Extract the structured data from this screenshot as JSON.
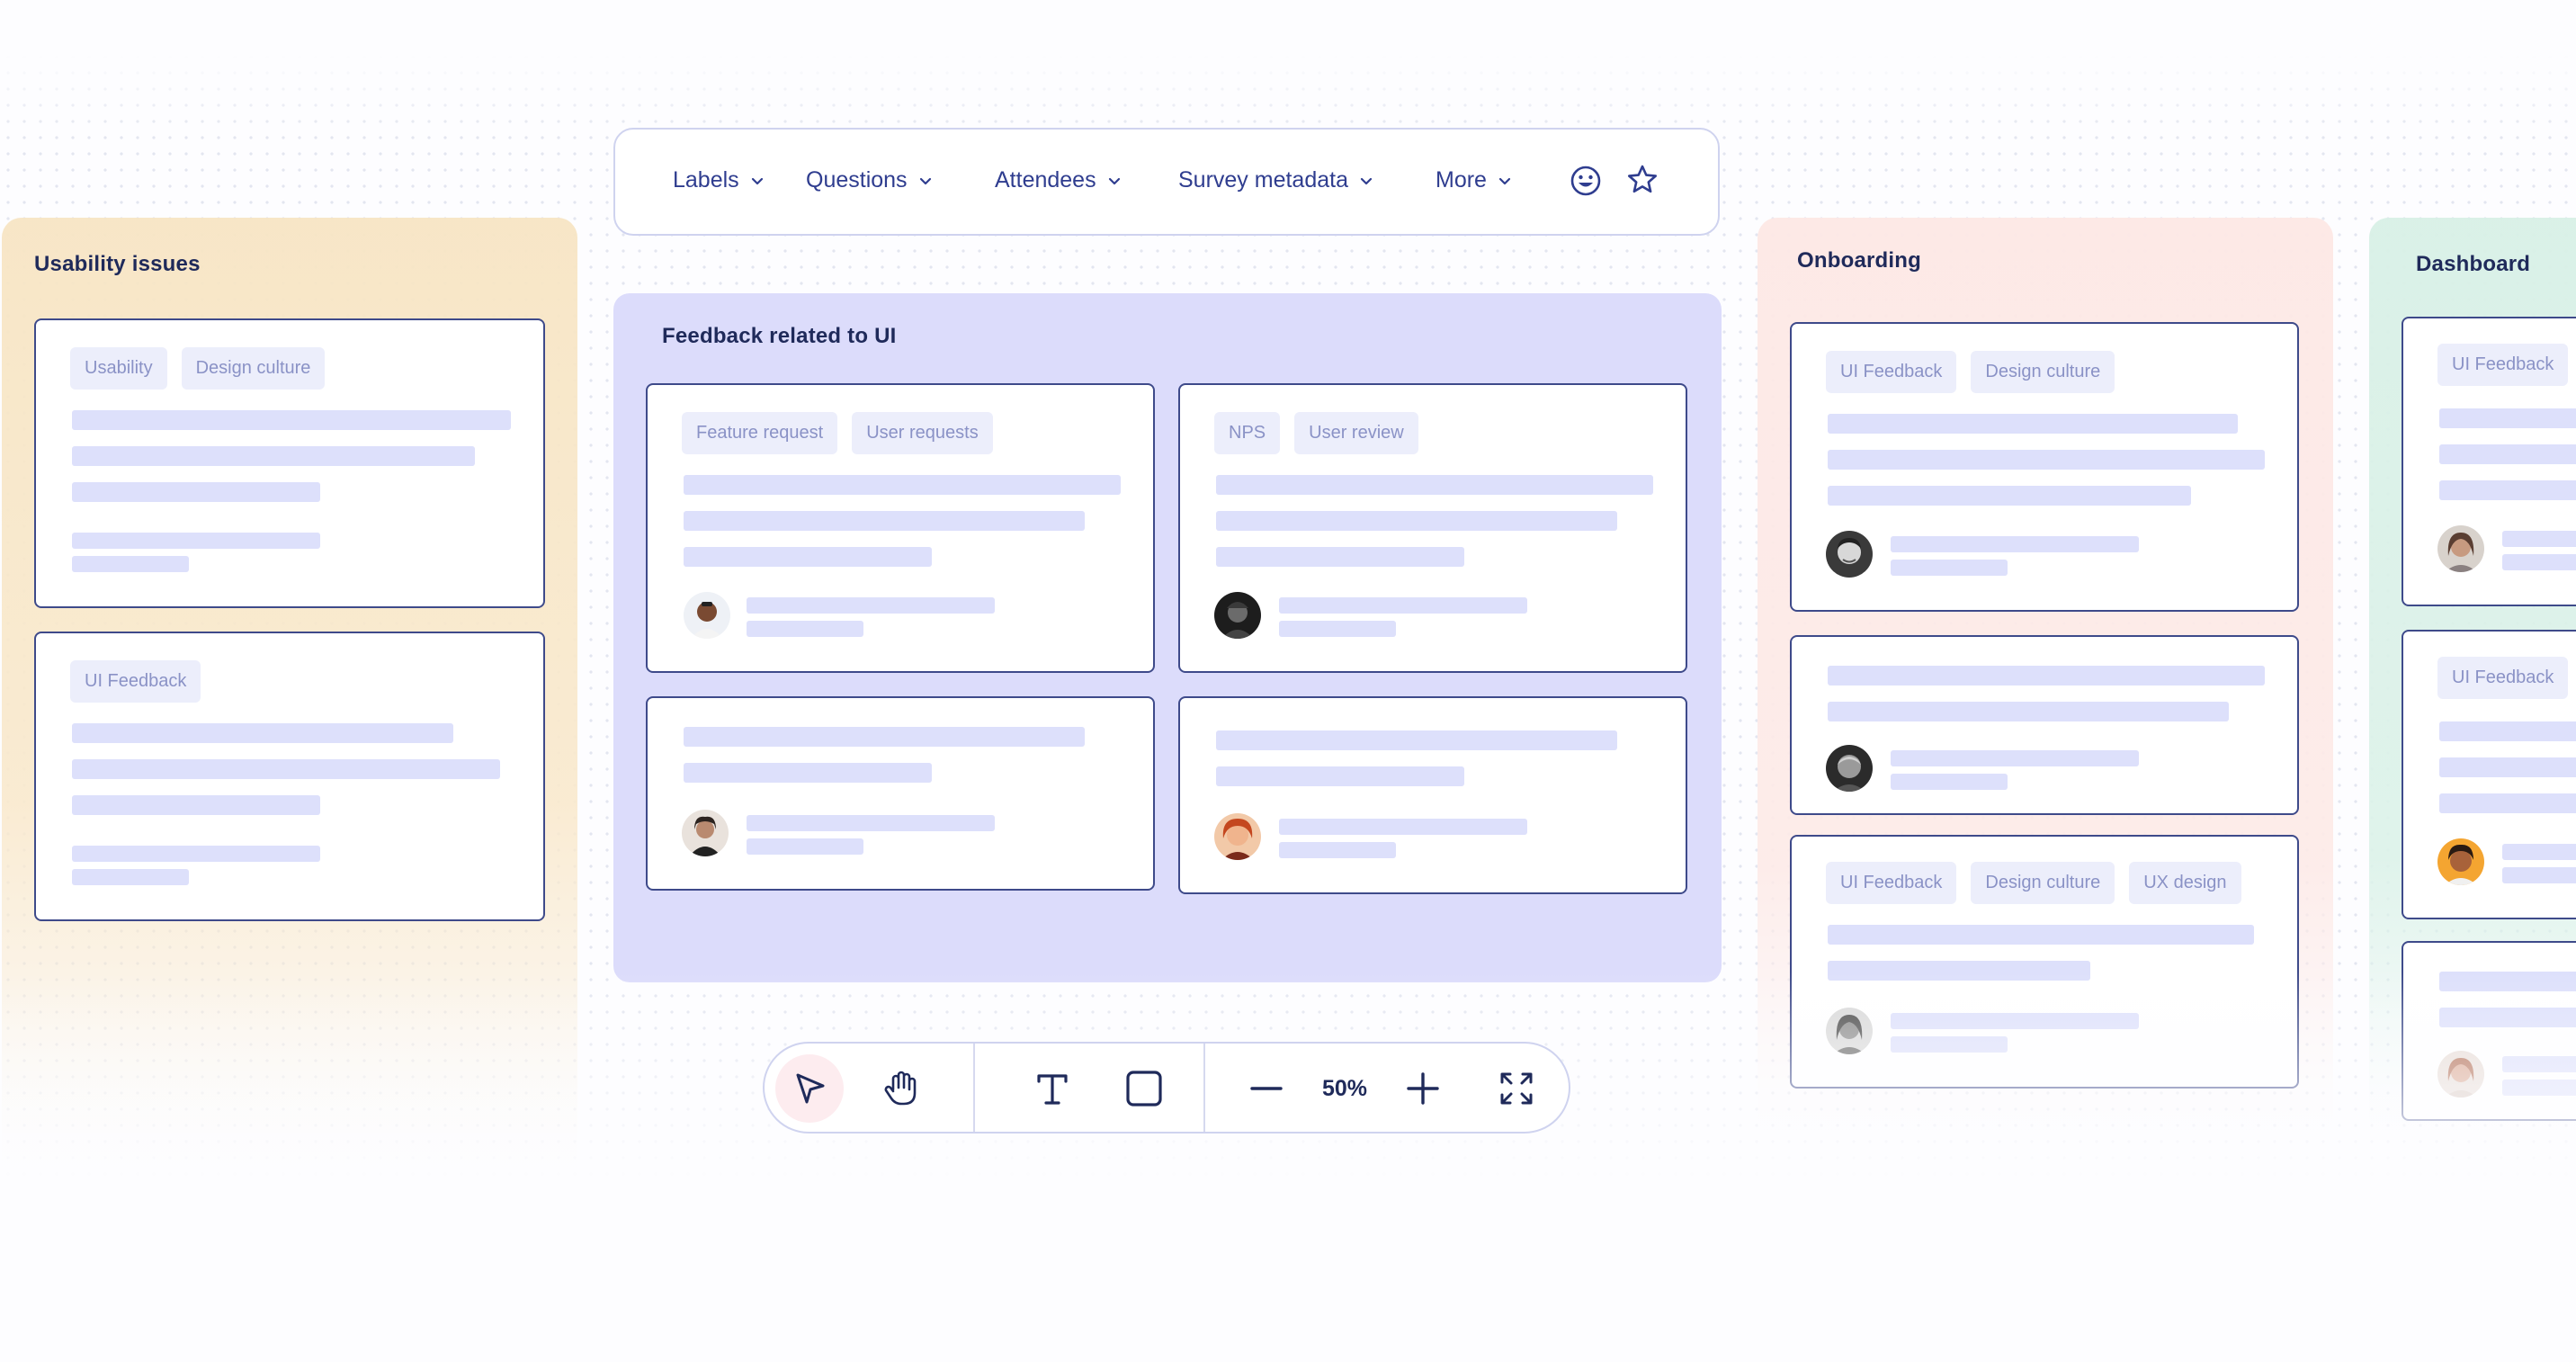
{
  "topmenu": {
    "items": [
      {
        "label": "Labels"
      },
      {
        "label": "Questions"
      },
      {
        "label": "Attendees"
      },
      {
        "label": "Survey metadata"
      },
      {
        "label": "More"
      }
    ]
  },
  "columns": {
    "usability": {
      "title": "Usability issues",
      "card1_tags": [
        "Usability",
        "Design culture"
      ],
      "card2_tags": [
        "UI Feedback"
      ]
    },
    "feedback_ui": {
      "title": "Feedback related to UI",
      "card1_tags": [
        "Feature request",
        "User requests"
      ],
      "card2_tags": [
        "NPS",
        "User review"
      ]
    },
    "onboarding": {
      "title": "Onboarding",
      "card1_tags": [
        "UI Feedback",
        "Design culture"
      ],
      "card3_tags": [
        "UI Feedback",
        "Design culture",
        "UX design"
      ]
    },
    "dashboard": {
      "title": "Dashboard",
      "card1_tags": [
        "UI Feedback"
      ],
      "card2_tags": [
        "UI Feedback"
      ]
    }
  },
  "toolbar": {
    "zoom": "50%"
  },
  "colors": {
    "accent": "#2f3d8f",
    "card_border": "#3e4a8a",
    "placeholder_bar": "#dde0fb",
    "usability_bg": "#f8e7c6",
    "feedback_bg": "#dcdcfb",
    "onboarding_bg": "#fde8e6",
    "dashboard_bg": "#d8f0e6"
  }
}
